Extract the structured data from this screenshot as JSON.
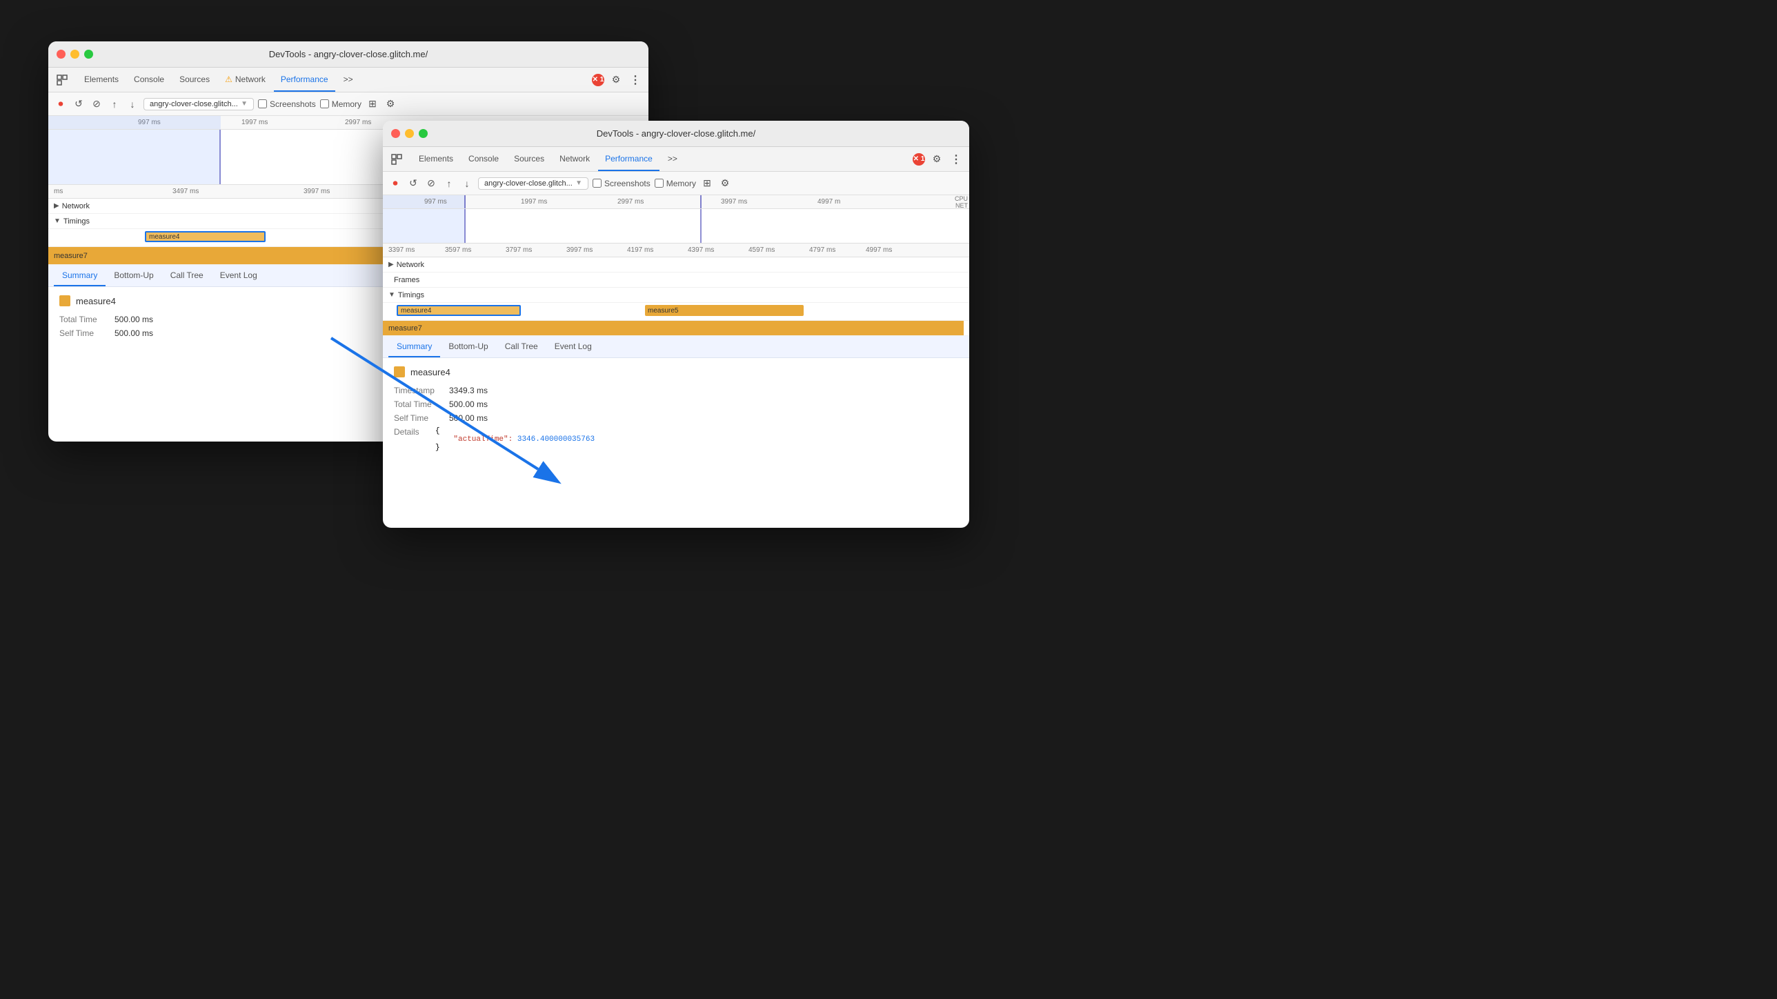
{
  "window1": {
    "title": "DevTools - angry-clover-close.glitch.me/",
    "tabs": [
      "Elements",
      "Console",
      "Sources",
      "Network",
      "Performance",
      ">>"
    ],
    "networkTab": "Network",
    "performanceTab": "Performance",
    "activeTab": "Performance",
    "controls": {
      "record": "⏺",
      "reload": "↺",
      "clear": "⊘",
      "upload": "↑",
      "download": "↓",
      "urlValue": "angry-clover-close.glitch...",
      "screenshots": "Screenshots",
      "memory": "Memory",
      "settings": "⚙"
    },
    "rulerMarks": [
      "997 ms",
      "1997 ms",
      "2997 ms"
    ],
    "rulerMarks2": [
      "ms",
      "3497 ms",
      "3997 ms"
    ],
    "tracks": {
      "network": "Network",
      "timings": "Timings",
      "measure4Label": "measure4",
      "measure7Label": "measure7"
    },
    "bottomTabs": [
      "Summary",
      "Bottom-Up",
      "Call Tree",
      "Event Log"
    ],
    "activeBottomTab": "Summary",
    "summary": {
      "title": "measure4",
      "totalTimeLabel": "Total Time",
      "totalTimeValue": "500.00 ms",
      "selfTimeLabel": "Self Time",
      "selfTimeValue": "500.00 ms"
    }
  },
  "window2": {
    "title": "DevTools - angry-clover-close.glitch.me/",
    "tabs": [
      "Elements",
      "Console",
      "Sources",
      "Network",
      "Performance",
      ">>"
    ],
    "networkTab": "Network",
    "performanceTab": "Performance",
    "activeTab": "Performance",
    "controls": {
      "record": "⏺",
      "reload": "↺",
      "clear": "⊘",
      "upload": "↑",
      "download": "↓",
      "urlValue": "angry-clover-close.glitch...",
      "screenshots": "Screenshots",
      "memory": "Memory",
      "settings": "⚙"
    },
    "rulerMarks": [
      "997 ms",
      "1997 ms",
      "2997 ms",
      "3997 ms",
      "4997 m"
    ],
    "rulerMarks2": [
      "3397 ms",
      "3597 ms",
      "3797 ms",
      "3997 ms",
      "4197 ms",
      "4397 ms",
      "4597 ms",
      "4797 ms",
      "4997 ms"
    ],
    "sideLabels": [
      "CPU",
      "NET"
    ],
    "tracks": {
      "frames": "Frames",
      "timings": "Timings",
      "measure4Label": "measure4",
      "measure5Label": "measure5",
      "measure7Label": "measure7"
    },
    "bottomTabs": [
      "Summary",
      "Bottom-Up",
      "Call Tree",
      "Event Log"
    ],
    "activeBottomTab": "Summary",
    "summary": {
      "title": "measure4",
      "timestampLabel": "Timestamp",
      "timestampValue": "3349.3 ms",
      "totalTimeLabel": "Total Time",
      "totalTimeValue": "500.00 ms",
      "selfTimeLabel": "Self Time",
      "selfTimeValue": "500.00 ms",
      "detailsLabel": "Details",
      "detailsOpen": "{",
      "detailsKey": "\"actualTime\":",
      "detailsValue": "3346.400000035763",
      "detailsClose": "}"
    }
  },
  "arrow": {
    "label": "blue-arrow"
  }
}
